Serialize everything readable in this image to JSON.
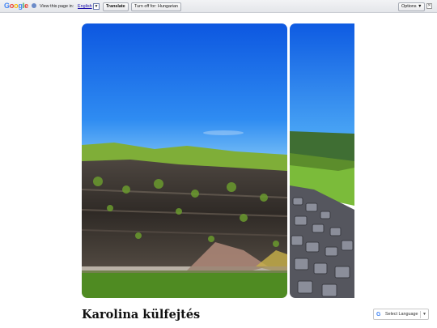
{
  "translate_bar": {
    "logo": "Google",
    "prompt": "View this page in:",
    "language": "English",
    "dropdown_glyph": "▼",
    "translate_label": "Translate",
    "turn_off_label": "Turn off for: Hungarian",
    "options_label": "Options ▼",
    "close_glyph": "✕"
  },
  "gallery": {
    "images": [
      {
        "name": "quarry-landscape"
      },
      {
        "name": "rock-pile-landscape"
      }
    ]
  },
  "post": {
    "title": "Karolina külfejtés"
  },
  "language_widget": {
    "label": "Select Language",
    "arrow": "▼",
    "icon": "google-g-icon"
  },
  "colors": {
    "sky_top": "#1565e6",
    "sky_bottom": "#4aa6f5",
    "grass": "#5f9a2d",
    "rock": "#3e3832"
  }
}
